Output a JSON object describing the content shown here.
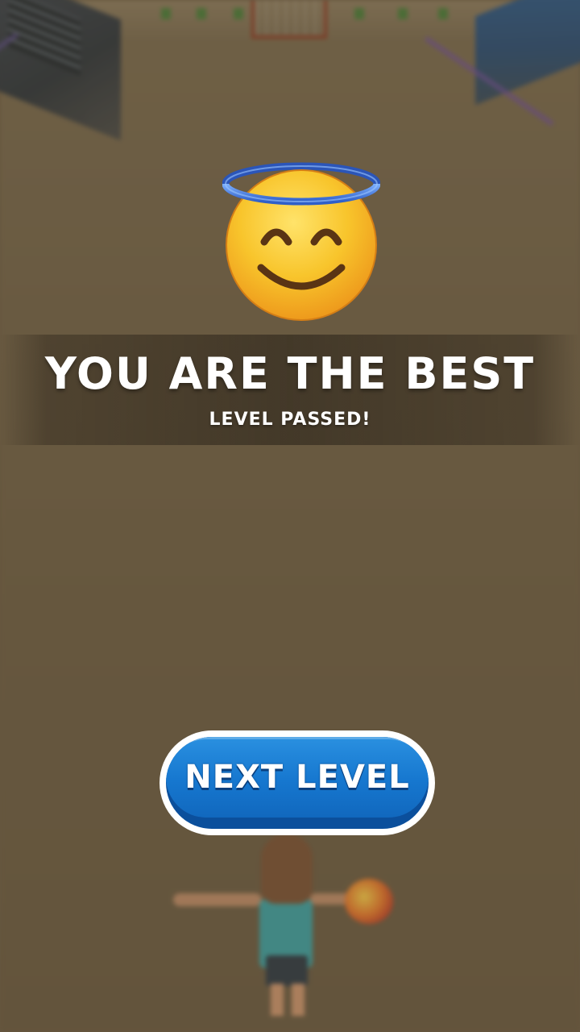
{
  "result": {
    "title": "YOU ARE THE BEST",
    "subtitle": "LEVEL PASSED!",
    "emoji": "smiling-face-with-halo"
  },
  "actions": {
    "next_level_label": "NEXT LEVEL"
  },
  "colors": {
    "button_blue": "#1677cf",
    "button_shadow": "#0b4f9c",
    "halo_blue": "#3a7be0",
    "emoji_yellow": "#f6c22a"
  }
}
